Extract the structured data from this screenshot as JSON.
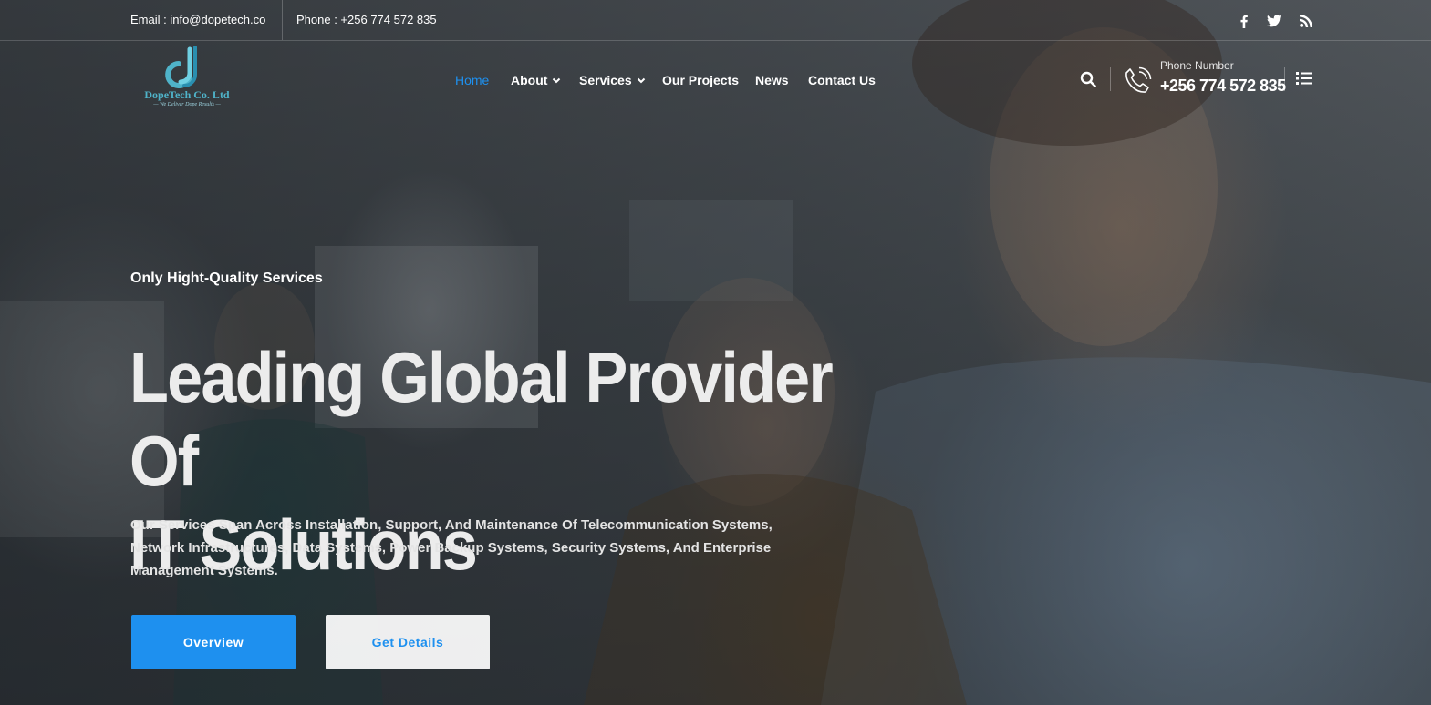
{
  "topbar": {
    "email": "Email : info@dopetech.co",
    "phone": "Phone : +256 774 572 835",
    "social": [
      "facebook-icon",
      "twitter-icon",
      "rss-icon"
    ]
  },
  "logo": {
    "name": "DopeTech Co. Ltd",
    "tagline": "— We Deliver Dope Results —"
  },
  "nav": {
    "items": [
      {
        "label": "Home",
        "active": true
      },
      {
        "label": "About",
        "dropdown": true
      },
      {
        "label": "Services",
        "dropdown": true
      },
      {
        "label": "Our Projects"
      },
      {
        "label": "News"
      },
      {
        "label": "Contact Us"
      }
    ]
  },
  "contact": {
    "caption": "Phone Number",
    "number": "+256 774 572 835"
  },
  "hero": {
    "eyebrow": "Only Hight-Quality Services",
    "headline_line1": "Leading Global Provider Of",
    "headline_line2": "IT Solutions",
    "subtext": "Our Services Span Across Installation, Support, And Maintenance Of Telecommunication Systems, Network Infrastructures, Data Systems, Power Backup Systems, Security Systems, And Enterprise Management Systems.",
    "primary_button": "Overview",
    "secondary_button": "Get Details"
  },
  "colors": {
    "accent": "#1e90ef",
    "logo": "#4fb3c9"
  }
}
